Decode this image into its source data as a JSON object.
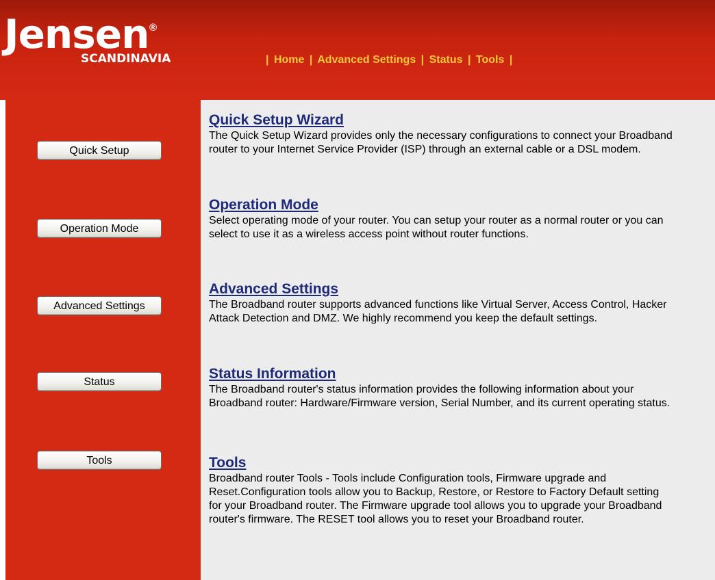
{
  "logo": {
    "brand": "Jensen",
    "registered": "®",
    "sub": "SCANDINAVIA"
  },
  "topnav": {
    "separator": "|",
    "items": [
      {
        "label": "Home"
      },
      {
        "label": "Advanced Settings"
      },
      {
        "label": "Status"
      },
      {
        "label": "Tools"
      }
    ]
  },
  "sidebar": {
    "buttons": [
      {
        "label": "Quick Setup"
      },
      {
        "label": "Operation Mode"
      },
      {
        "label": "Advanced Settings"
      },
      {
        "label": "Status"
      },
      {
        "label": "Tools"
      }
    ]
  },
  "sections": [
    {
      "title": "Quick Setup Wizard",
      "text": "The Quick Setup Wizard provides only the necessary configurations to connect your Broadband router to your Internet Service Provider (ISP) through an external cable or a DSL modem."
    },
    {
      "title": "Operation Mode",
      "text": "Select operating mode of your router. You can setup your router as a normal router or you can select to use it as a wireless access point without router functions."
    },
    {
      "title": "Advanced Settings",
      "text": "The Broadband router supports advanced functions like Virtual Server, Access Control, Hacker Attack Detection and DMZ. We highly recommend you keep the default settings."
    },
    {
      "title": "Status Information",
      "text": "The Broadband router's status information provides the following information about your Broadband router: Hardware/Firmware version, Serial Number, and its current operating status."
    },
    {
      "title": "Tools",
      "text": "Broadband router Tools - Tools include Configuration tools, Firmware upgrade and Reset.Configuration tools allow you to Backup, Restore, or Restore to Factory Default setting for your Broadband router. The Firmware upgrade tool allows you to upgrade your Broadband router's firmware. The RESET tool allows you to reset your Broadband router."
    }
  ],
  "colors": {
    "header_red": "#c8230f",
    "sidebar_red": "#d42a14",
    "nav_yellow": "#f4c83c",
    "title_blue": "#1e2a78",
    "content_bg": "#ececec"
  }
}
